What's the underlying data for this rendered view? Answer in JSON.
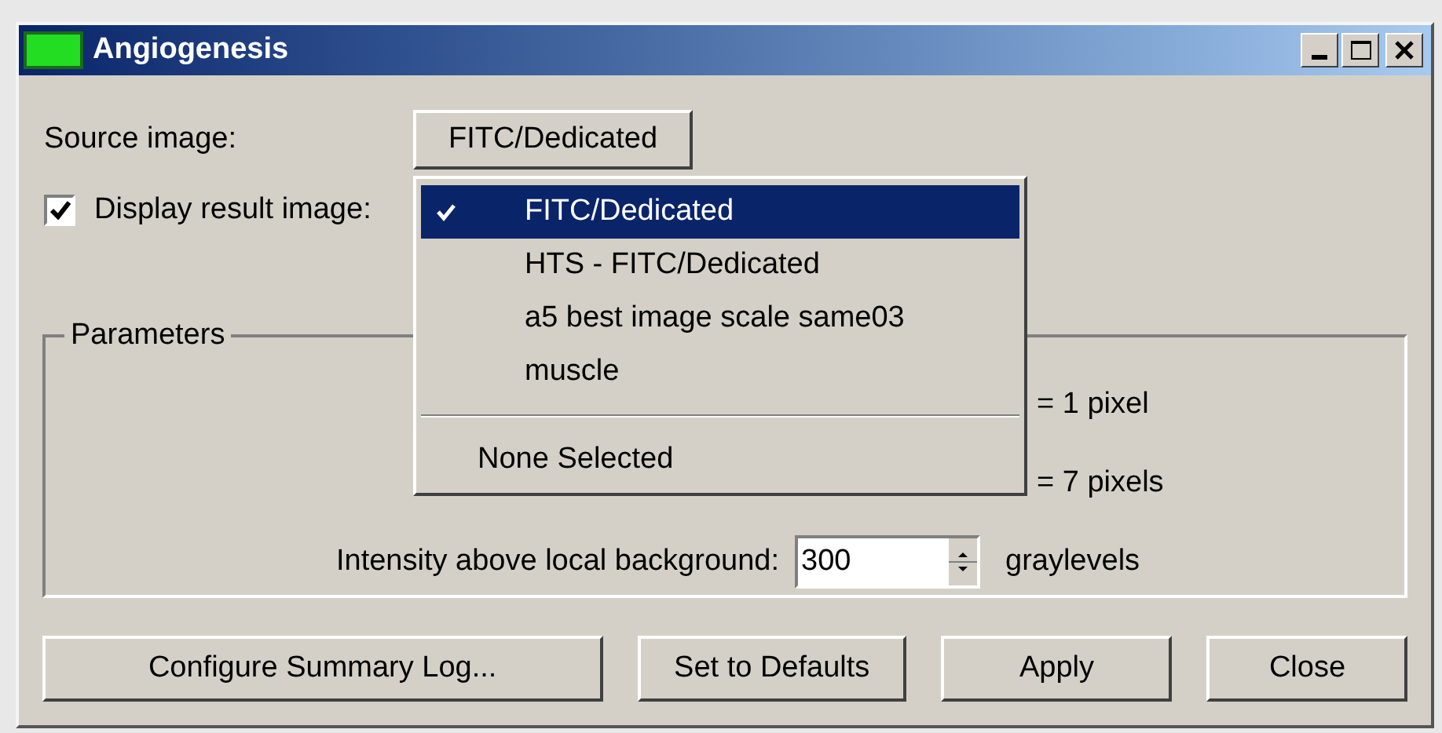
{
  "window": {
    "title": "Angiogenesis"
  },
  "source_image": {
    "label": "Source image:",
    "value": "FITC/Dedicated"
  },
  "display_result": {
    "label": "Display result image:",
    "checked": true
  },
  "source_menu": {
    "items": [
      {
        "label": "FITC/Dedicated",
        "selected": true
      },
      {
        "label": "HTS - FITC/Dedicated",
        "selected": false
      },
      {
        "label": "a5 best image scale same03",
        "selected": false
      },
      {
        "label": "muscle",
        "selected": false
      },
      {
        "kind": "separator"
      },
      {
        "label": "None Selected",
        "selected": false,
        "kind": "plain"
      }
    ]
  },
  "parameters": {
    "title": "Parameters",
    "rows": [
      {
        "unit": "= 1 pixel"
      },
      {
        "unit": "= 7 pixels"
      },
      {
        "label": "Intensity above local background:",
        "value": "300",
        "unit": "graylevels"
      }
    ]
  },
  "buttons": [
    "Configure Summary Log...",
    "Set to Defaults",
    "Apply",
    "Close"
  ]
}
